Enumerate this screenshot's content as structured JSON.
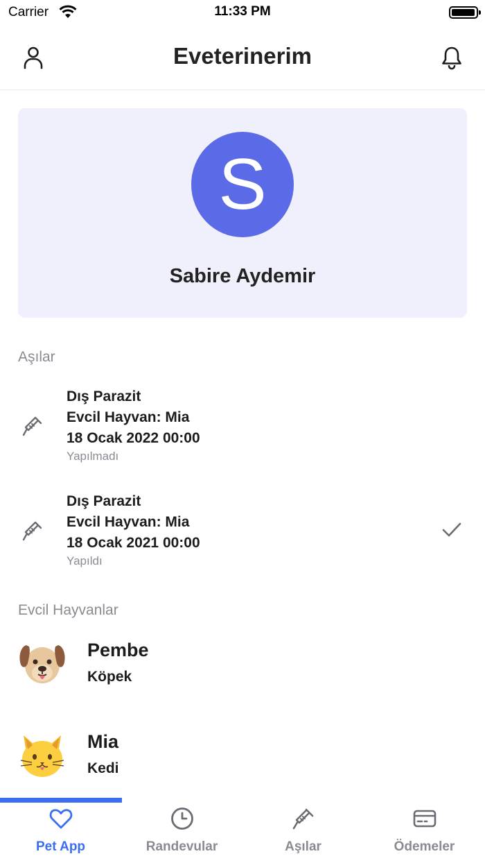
{
  "status_bar": {
    "carrier": "Carrier",
    "time": "11:33 PM"
  },
  "header": {
    "title": "Eveterinerim",
    "left_icon": "person-icon",
    "right_icon": "bell-icon"
  },
  "profile": {
    "initial": "S",
    "name": "Sabire Aydemir",
    "avatar_color": "#5b6ae6"
  },
  "vaccines": {
    "title": "Aşılar",
    "items": [
      {
        "name": "Dış Parazit",
        "pet": "Evcil Hayvan: Mia",
        "date": "18 Ocak 2022 00:00",
        "status": "Yapılmadı",
        "done": false
      },
      {
        "name": "Dış Parazit",
        "pet": "Evcil Hayvan: Mia",
        "date": "18 Ocak 2021 00:00",
        "status": "Yapıldı",
        "done": true
      }
    ]
  },
  "pets": {
    "title": "Evcil Hayvanlar",
    "items": [
      {
        "name": "Pembe",
        "type": "Köpek",
        "icon": "dog-face-icon"
      },
      {
        "name": "Mia",
        "type": "Kedi",
        "icon": "cat-face-icon"
      }
    ]
  },
  "tabs": [
    {
      "label": "Pet App",
      "icon": "heart-icon",
      "active": true
    },
    {
      "label": "Randevular",
      "icon": "clock-icon",
      "active": false
    },
    {
      "label": "Aşılar",
      "icon": "syringe-icon",
      "active": false
    },
    {
      "label": "Ödemeler",
      "icon": "credit-card-icon",
      "active": false
    }
  ],
  "colors": {
    "accent": "#3a6df0",
    "card_bg": "#f0f0fc",
    "muted": "#8a8a93"
  }
}
